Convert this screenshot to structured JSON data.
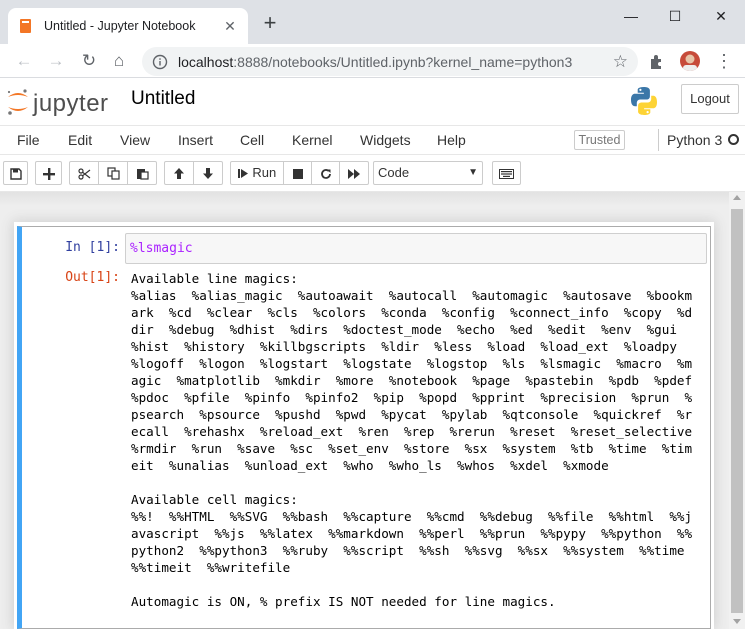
{
  "browser": {
    "tab_title": "Untitled - Jupyter Notebook",
    "tab_close": "✕",
    "new_tab": "+",
    "minimize": "—",
    "maximize": "☐",
    "close": "✕",
    "url_host": "localhost",
    "url_path": ":8888/notebooks/Untitled.ipynb?kernel_name=python3",
    "star": "☆",
    "menu": "⋮"
  },
  "header": {
    "logo_text": "jupyter",
    "notebook_name": "Untitled",
    "logout_label": "Logout"
  },
  "menubar": {
    "items": [
      "File",
      "Edit",
      "View",
      "Insert",
      "Cell",
      "Kernel",
      "Widgets",
      "Help"
    ],
    "trusted": "Trusted",
    "kernel": "Python 3"
  },
  "toolbar": {
    "run_label": "Run",
    "cell_type": "Code"
  },
  "cell": {
    "in_prompt": "In [1]:",
    "input_magic": "%lsmagic",
    "out_prompt": "Out[1]:",
    "output_lines": [
      "Available line magics:",
      "%alias  %alias_magic  %autoawait  %autocall  %automagic  %autosave  %bookm",
      "ark  %cd  %clear  %cls  %colors  %conda  %config  %connect_info  %copy  %d",
      "dir  %debug  %dhist  %dirs  %doctest_mode  %echo  %ed  %edit  %env  %gui",
      "%hist  %history  %killbgscripts  %ldir  %less  %load  %load_ext  %loadpy",
      "%logoff  %logon  %logstart  %logstate  %logstop  %ls  %lsmagic  %macro  %m",
      "agic  %matplotlib  %mkdir  %more  %notebook  %page  %pastebin  %pdb  %pdef",
      "%pdoc  %pfile  %pinfo  %pinfo2  %pip  %popd  %pprint  %precision  %prun  %",
      "psearch  %psource  %pushd  %pwd  %pycat  %pylab  %qtconsole  %quickref  %r",
      "ecall  %rehashx  %reload_ext  %ren  %rep  %rerun  %reset  %reset_selective",
      "%rmdir  %run  %save  %sc  %set_env  %store  %sx  %system  %tb  %time  %tim",
      "eit  %unalias  %unload_ext  %who  %who_ls  %whos  %xdel  %xmode",
      "",
      "Available cell magics:",
      "%%!  %%HTML  %%SVG  %%bash  %%capture  %%cmd  %%debug  %%file  %%html  %%j",
      "avascript  %%js  %%latex  %%markdown  %%perl  %%prun  %%pypy  %%python  %%",
      "python2  %%python3  %%ruby  %%script  %%sh  %%svg  %%sx  %%system  %%time",
      "%%timeit  %%writefile",
      "",
      "Automagic is ON, % prefix IS NOT needed for line magics."
    ]
  }
}
